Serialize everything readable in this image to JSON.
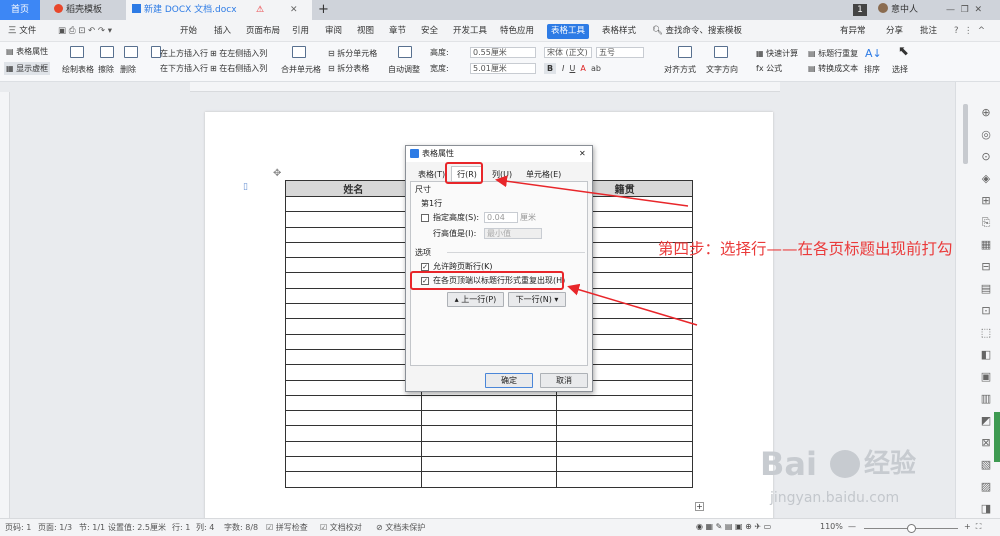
{
  "tabs": [
    {
      "label": "首页"
    },
    {
      "label": "稻壳模板"
    },
    {
      "label": "新建 DOCX 文档.docx"
    }
  ],
  "tab_badge": "1",
  "user_name": "意中人",
  "menu": {
    "file": "三 文件",
    "items": [
      "开始",
      "插入",
      "页面布局",
      "引用",
      "审阅",
      "视图",
      "章节",
      "安全",
      "开发工具",
      "特色应用",
      "表格工具",
      "表格样式"
    ],
    "search": "查找命令、搜索模板",
    "right": [
      "有异常",
      "分享",
      "批注"
    ]
  },
  "ribbon": {
    "table_props": "表格属性",
    "show_grid": "显示虚框",
    "draw_table": "绘制表格",
    "erase": "擦除",
    "delete": "删除",
    "summary": "汇总",
    "ins_above": "在上方插入行",
    "ins_below": "在下方插入行",
    "ins_left": "在左侧插入列",
    "ins_right": "在右侧插入列",
    "merge": "合并单元格",
    "split_cell": "拆分单元格",
    "split_table": "拆分表格",
    "autofit": "自动调整",
    "height_label": "高度:",
    "height_val": "0.55厘米",
    "width_label": "宽度:",
    "width_val": "5.01厘米",
    "font": "宋体 (正文)",
    "size": "五号",
    "align": "对齐方式",
    "direction": "文字方向",
    "quick_calc": "快速计算",
    "formula": "fx 公式",
    "title_repeat": "标题行重复",
    "to_text": "转换成文本",
    "sort": "排序",
    "select": "选择"
  },
  "table": {
    "headers": [
      "姓名",
      "",
      "籍贯"
    ],
    "rows": 19
  },
  "dialog": {
    "title": "表格属性",
    "tabs": [
      "表格(T)",
      "行(R)",
      "列(U)",
      "单元格(E)"
    ],
    "size_label": "尺寸",
    "row_label": "第1行",
    "specify_height": "指定高度(S):",
    "height_value": "0.04",
    "unit": "厘米",
    "row_height_is": "行高值是(I):",
    "row_height_mode": "最小值",
    "options_label": "选项",
    "allow_break": "允许跨页断行(K)",
    "repeat_header": "在各页顶端以标题行形式重复出现(H)",
    "prev_row": "上一行(P)",
    "next_row": "下一行(N)",
    "ok": "确定",
    "cancel": "取消"
  },
  "annotation": "第四步：选择行——在各页标题出现前打勾",
  "status": {
    "page_no": "页码: 1",
    "pages": "页面: 1/3",
    "section": "节: 1/1",
    "setting": "设置值: 2.5厘米",
    "row": "行: 1",
    "col": "列: 4",
    "words": "字数: 8/8",
    "spell": "拼写检查",
    "proof": "文档校对",
    "protect": "文档未保护",
    "zoom": "110%"
  },
  "watermark": {
    "brand": "Bai",
    "brand2": "经验",
    "url": "jingyan.baidu.com"
  },
  "colors": {
    "accent": "#2d7be5",
    "annotation": "#e8262a",
    "tab_active": "#f3f4f6"
  }
}
